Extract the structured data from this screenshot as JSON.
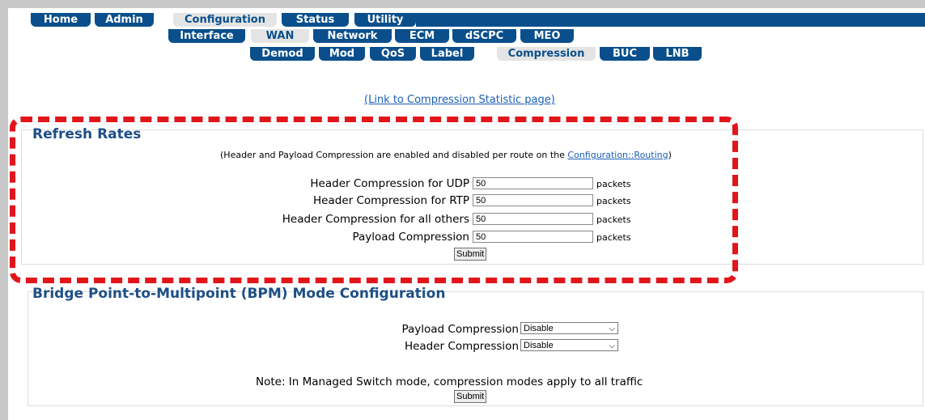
{
  "nav": {
    "row1": [
      "Home",
      "Admin",
      "Configuration",
      "Status",
      "Utility"
    ],
    "row2": [
      "Interface",
      "WAN",
      "Network",
      "ECM",
      "dSCPC",
      "MEO"
    ],
    "row3": [
      "Demod",
      "Mod",
      "QoS",
      "Label",
      "Compression",
      "BUC",
      "LNB"
    ]
  },
  "link_text": "(Link to Compression Statistic page)",
  "refresh": {
    "title": "Refresh Rates",
    "note_prefix": "(Header and Payload Compression are enabled and disabled per route on the ",
    "note_link": "Configuration::Routing",
    "note_suffix": ")",
    "rows": [
      {
        "label": "Header Compression for UDP",
        "value": "50",
        "unit": "packets"
      },
      {
        "label": "Header Compression for RTP",
        "value": "50",
        "unit": "packets"
      },
      {
        "label": "Header Compression for all others",
        "value": "50",
        "unit": "packets"
      },
      {
        "label": "Payload Compression",
        "value": "50",
        "unit": "packets"
      }
    ],
    "submit": "Submit"
  },
  "bpm": {
    "title": "Bridge Point-to-Multipoint (BPM) Mode Configuration",
    "payload_label": "Payload Compression",
    "payload_value": "Disable",
    "header_label": "Header Compression",
    "header_value": "Disable",
    "note": "Note: In Managed Switch mode, compression modes apply to all traffic",
    "submit": "Submit"
  },
  "colors": {
    "nav_blue": "#0a4f8c",
    "title_blue": "#1d4f86",
    "highlight_red": "#e0161b"
  }
}
